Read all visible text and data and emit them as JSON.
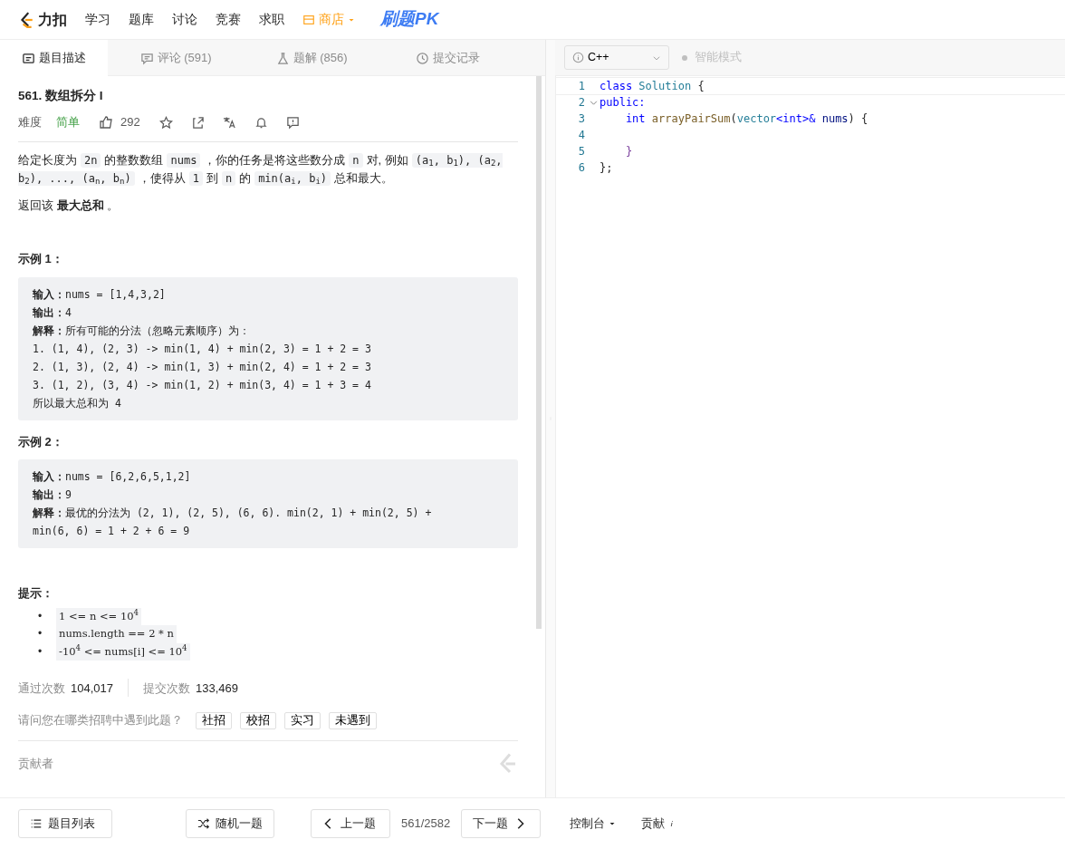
{
  "nav": {
    "logo": "力扣",
    "items": [
      {
        "label": "学习",
        "kind": "link"
      },
      {
        "label": "题库",
        "kind": "link"
      },
      {
        "label": "讨论",
        "kind": "link"
      },
      {
        "label": "竞赛",
        "kind": "link"
      },
      {
        "label": "求职",
        "kind": "link"
      },
      {
        "label": "商店",
        "kind": "store"
      }
    ],
    "promo": "刷题PK"
  },
  "tabs": [
    {
      "label": "题目描述",
      "selected": true
    },
    {
      "label": "评论 (591)",
      "selected": false
    },
    {
      "label": "题解 (856)",
      "selected": false
    },
    {
      "label": "提交记录",
      "selected": false
    }
  ],
  "problem": {
    "title": "561. 数组拆分 I",
    "difficulty_label": "难度",
    "difficulty": "简单",
    "likes": "292",
    "description": [
      {
        "text": "给定长度为",
        "code": false
      },
      {
        "text": "2n",
        "code": true
      },
      {
        "text": "的整数数组",
        "code": false
      },
      {
        "text": "nums",
        "code": true
      },
      {
        "text": "，你的任务是将这些数分成",
        "code": false
      },
      {
        "text": "n",
        "code": true
      },
      {
        "text": "对, 例如",
        "code": false
      },
      {
        "text": "(a$_{1}$, b$_{1}$), (a$_{2}$, b$_{2}$), ..., (a$_{n}$, b$_{n}$)",
        "code": true
      },
      {
        "text": "，使得从",
        "code": false
      },
      {
        "text": "1",
        "code": true
      },
      {
        "text": "到",
        "code": false
      },
      {
        "text": "n",
        "code": true
      },
      {
        "text": "的",
        "code": false
      },
      {
        "text": "min(a$_{i}$, b$_{i}$)",
        "code": true
      },
      {
        "text": "总和最大。",
        "code": false
      }
    ],
    "return_text": "返回该 **最大总和** 。",
    "examples": [
      {
        "heading": "示例 1：",
        "lines": [
          {
            "label": "输入：",
            "text": "nums = [1,4,3,2]"
          },
          {
            "label": "输出：",
            "text": "4"
          },
          {
            "label": "解释：",
            "text": "所有可能的分法（忽略元素顺序）为："
          },
          {
            "text": "1. (1, 4), (2, 3) -> min(1, 4) + min(2, 3) = 1 + 2 = 3"
          },
          {
            "text": "2. (1, 3), (2, 4) -> min(1, 3) + min(2, 4) = 1 + 2 = 3"
          },
          {
            "text": "3. (1, 2), (3, 4) -> min(1, 2) + min(3, 4) = 1 + 3 = 4"
          },
          {
            "text": "所以最大总和为 4"
          }
        ]
      },
      {
        "heading": "示例 2：",
        "lines": [
          {
            "label": "输入：",
            "text": "nums = [6,2,6,5,1,2]"
          },
          {
            "label": "输出：",
            "text": "9"
          },
          {
            "label": "解释：",
            "text": "最优的分法为 (2, 1), (2, 5), (6, 6). min(2, 1) + min(2, 5) + min(6, 6) = 1 + 2 + 6 = 9"
          }
        ]
      }
    ],
    "hints_heading": "提示：",
    "constraints": [
      {
        "bullet": "•",
        "text": "1 <= n <= 10$^{4}$"
      },
      {
        "bullet": "•",
        "text": "nums.length == 2 * n"
      },
      {
        "bullet": "•",
        "text": "-10$^{4}$ <= nums[i] <= 10$^{4}$"
      }
    ],
    "stats": [
      {
        "label": "通过次数",
        "value": "104,017"
      },
      {
        "label": "提交次数",
        "value": "133,469"
      }
    ],
    "survey": {
      "question": "请问您在哪类招聘中遇到此题？",
      "options": [
        "社招",
        "校招",
        "实习",
        "未遇到"
      ]
    },
    "contributors_label": "贡献者"
  },
  "editor": {
    "language": "C++",
    "smart_mode": {
      "label": "智能模式",
      "on": false
    },
    "lines": [
      {
        "number": "1",
        "fold": false,
        "tokens": [
          {
            "text": "class",
            "kind": "keyword"
          },
          {
            "text": " Solution",
            "kind": "type"
          },
          {
            "text": " {"
          }
        ]
      },
      {
        "number": "2",
        "fold": true,
        "tokens": [
          {
            "text": "public:",
            "kind": "keyword"
          }
        ]
      },
      {
        "number": "3",
        "fold": false,
        "tokens": [
          {
            "text": "    int",
            "kind": "keyword"
          },
          {
            "text": " arrayPairSum",
            "kind": "function"
          },
          {
            "text": "("
          },
          {
            "text": "vector",
            "kind": "type"
          },
          {
            "text": "<int>&",
            "kind": "keyword"
          },
          {
            "text": " nums",
            "kind": "variable"
          },
          {
            "text": ") {"
          }
        ]
      },
      {
        "number": "4",
        "fold": false
      },
      {
        "number": "5",
        "fold": false,
        "tokens": [
          {
            "text": "    }",
            "kind": "brace"
          }
        ]
      },
      {
        "number": "6",
        "fold": false,
        "tokens": [
          {
            "text": "};"
          }
        ]
      }
    ]
  },
  "footer": {
    "problem_list": "题目列表",
    "random": "随机一题",
    "prev": "上一题",
    "counter": "561/2582",
    "next": "下一题",
    "console": "控制台",
    "contribute": "贡献 "
  }
}
